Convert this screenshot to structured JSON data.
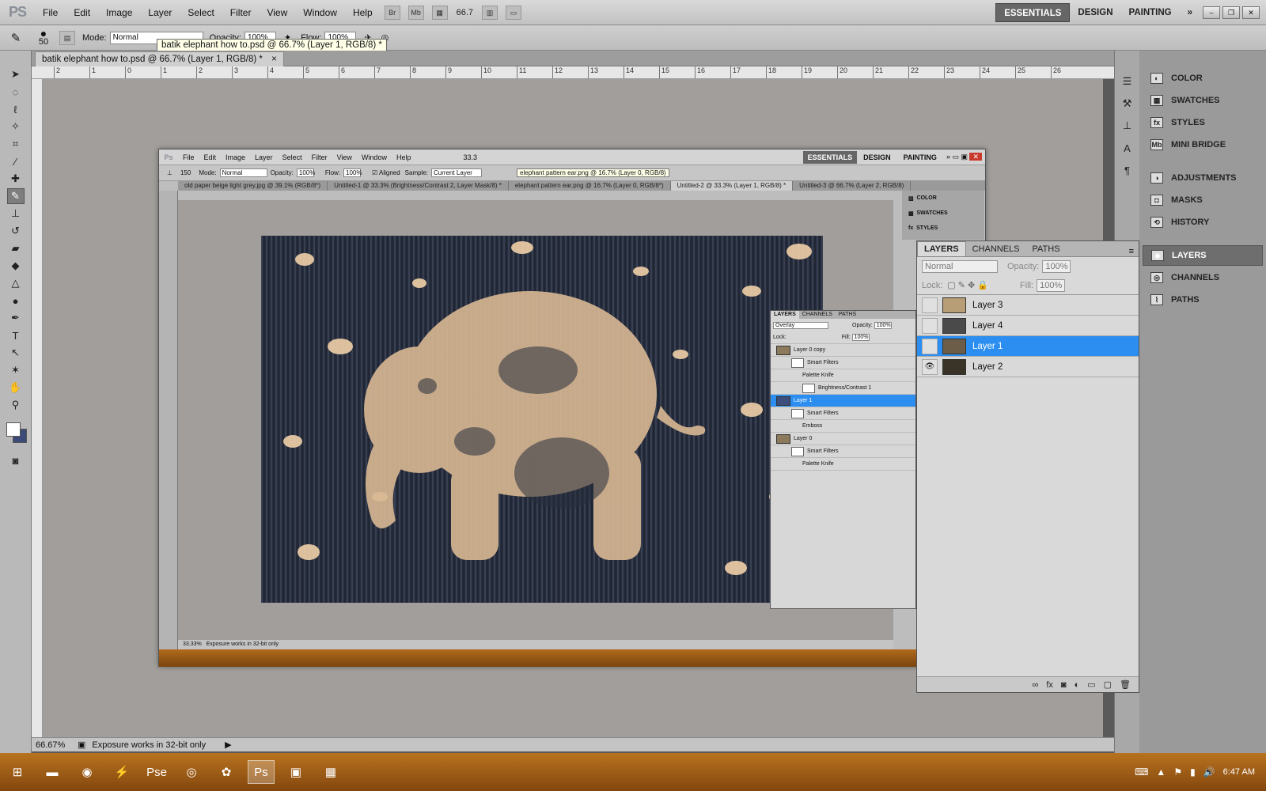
{
  "menubar": {
    "logo": "PS",
    "items": [
      "File",
      "Edit",
      "Image",
      "Layer",
      "Select",
      "Filter",
      "View",
      "Window",
      "Help"
    ],
    "zoom": "66.7",
    "workspaces": [
      "ESSENTIALS",
      "DESIGN",
      "PAINTING"
    ],
    "more": "»"
  },
  "optbar": {
    "brush_size": "50",
    "mode_label": "Mode:",
    "mode_value": "Normal",
    "opacity_label": "Opacity:",
    "opacity_value": "100%",
    "flow_label": "Flow:",
    "flow_value": "100%"
  },
  "tooltip": "batik elephant how to.psd @ 66.7% (Layer 1, RGB/8) *",
  "doc_tab": {
    "title": "batik elephant how to.psd @ 66.7% (Layer 1, RGB/8) *",
    "close": "×"
  },
  "ruler_marks": [
    "2",
    "1",
    "0",
    "1",
    "2",
    "3",
    "4",
    "5",
    "6",
    "7",
    "8",
    "9",
    "10",
    "11",
    "12",
    "13",
    "14",
    "15",
    "16",
    "17",
    "18",
    "19",
    "20",
    "21",
    "22",
    "23",
    "24",
    "25",
    "26"
  ],
  "status": {
    "zoom": "66.67%",
    "info": "Exposure works in 32-bit only"
  },
  "right_panels": [
    {
      "label": "COLOR",
      "icon": "color-icon"
    },
    {
      "label": "SWATCHES",
      "icon": "swatches-icon"
    },
    {
      "label": "STYLES",
      "icon": "styles-icon"
    },
    {
      "label": "MINI BRIDGE",
      "icon": "mini-bridge-icon"
    },
    {
      "label": "ADJUSTMENTS",
      "icon": "adjustments-icon"
    },
    {
      "label": "MASKS",
      "icon": "masks-icon"
    },
    {
      "label": "HISTORY",
      "icon": "history-icon"
    },
    {
      "label": "LAYERS",
      "icon": "layers-icon"
    },
    {
      "label": "CHANNELS",
      "icon": "channels-icon"
    },
    {
      "label": "PATHS",
      "icon": "paths-icon"
    }
  ],
  "layers_panel": {
    "tabs": [
      "LAYERS",
      "CHANNELS",
      "PATHS"
    ],
    "blend_mode": "Normal",
    "opacity_label": "Opacity:",
    "opacity_value": "100%",
    "lock_label": "Lock:",
    "fill_label": "Fill:",
    "fill_value": "100%",
    "layers": [
      {
        "name": "Layer 3",
        "visible": false,
        "selected": false
      },
      {
        "name": "Layer 4",
        "visible": false,
        "selected": false
      },
      {
        "name": "Layer 1",
        "visible": false,
        "selected": true
      },
      {
        "name": "Layer 2",
        "visible": true,
        "selected": false
      }
    ]
  },
  "inner": {
    "menu": [
      "File",
      "Edit",
      "Image",
      "Layer",
      "Select",
      "Filter",
      "View",
      "Window",
      "Help"
    ],
    "zoom": "33.3",
    "workspaces": [
      "ESSENTIALS",
      "DESIGN",
      "PAINTING"
    ],
    "opt": {
      "size": "150",
      "mode_label": "Mode:",
      "mode": "Normal",
      "opacity_label": "Opacity:",
      "opacity": "100%",
      "flow_label": "Flow:",
      "flow": "100%",
      "aligned": "Aligned",
      "sample_label": "Sample:",
      "sample": "Current Layer"
    },
    "tooltip": "elephant pattern ear.png @ 16.7% (Layer 0, RGB/8)",
    "tabs": [
      "old paper beige light grey.jpg @ 39.1% (RGB/8*)",
      "Untitled-1 @ 33.3% (Brightness/Contrast 2, Layer Mask/8) *",
      "elephant pattern ear.png @ 16.7% (Layer 0, RGB/8*)",
      "Untitled-2 @ 33.3% (Layer 1, RGB/8) *",
      "Untitled-3 @ 66.7% (Layer 2, RGB/8)"
    ],
    "status_zoom": "33.33%",
    "status_info": "Exposure works in 32-bit only",
    "right_items": [
      "COLOR",
      "SWATCHES",
      "STYLES"
    ],
    "layers_tabs": [
      "LAYERS",
      "CHANNELS",
      "PATHS"
    ],
    "blend": "Overlay",
    "opacity_label": "Opacity:",
    "opacity": "100%",
    "lock_label": "Lock:",
    "fill_label": "Fill:",
    "fill": "100%",
    "rows": [
      {
        "label": "Layer 0 copy",
        "kind": "layer"
      },
      {
        "label": "Smart Filters",
        "kind": "smart"
      },
      {
        "label": "Palette Knife",
        "kind": "filter"
      },
      {
        "label": "Brightness/Contrast 1",
        "kind": "adjust"
      },
      {
        "label": "Layer 1",
        "kind": "layer",
        "selected": true
      },
      {
        "label": "Smart Filters",
        "kind": "smart"
      },
      {
        "label": "Emboss",
        "kind": "filter"
      },
      {
        "label": "Layer 0",
        "kind": "layer"
      },
      {
        "label": "Smart Filters",
        "kind": "smart"
      },
      {
        "label": "Palette Knife",
        "kind": "filter"
      }
    ]
  },
  "taskbar": {
    "apps": [
      "start-icon",
      "file-explorer-icon",
      "chrome-icon",
      "winamp-icon",
      "photoshop-elements-icon",
      "camera-icon",
      "paint-icon",
      "photoshop-icon",
      "photo-viewer-icon",
      "calculator-icon"
    ],
    "time": "6:47 AM"
  },
  "colors": {
    "accent": "#2b8ef0",
    "taskbar": "#a8621a",
    "canvas": "#a19e9b"
  }
}
